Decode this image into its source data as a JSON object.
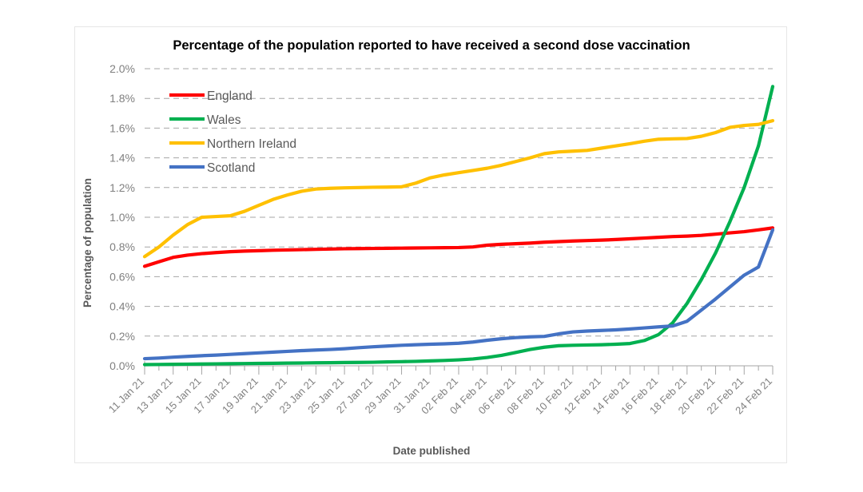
{
  "chart_data": {
    "type": "line",
    "title": "Percentage of the population reported to have received a second dose vaccination",
    "xlabel": "Date published",
    "ylabel": "Percentage of population",
    "ylim": [
      0,
      2.0
    ],
    "ytick_step": 0.2,
    "ytick_labels": [
      "0.0%",
      "0.2%",
      "0.4%",
      "0.6%",
      "0.8%",
      "1.0%",
      "1.2%",
      "1.4%",
      "1.6%",
      "1.8%",
      "2.0%"
    ],
    "grid": true,
    "legend_position": "top-left",
    "unit": "%",
    "x": [
      "11 Jan 21",
      "12 Jan 21",
      "13 Jan 21",
      "14 Jan 21",
      "15 Jan 21",
      "16 Jan 21",
      "17 Jan 21",
      "18 Jan 21",
      "19 Jan 21",
      "20 Jan 21",
      "21 Jan 21",
      "22 Jan 21",
      "23 Jan 21",
      "24 Jan 21",
      "25 Jan 21",
      "26 Jan 21",
      "27 Jan 21",
      "28 Jan 21",
      "29 Jan 21",
      "30 Jan 21",
      "31 Jan 21",
      "01 Feb 21",
      "02 Feb 21",
      "03 Feb 21",
      "04 Feb 21",
      "05 Feb 21",
      "06 Feb 21",
      "07 Feb 21",
      "08 Feb 21",
      "09 Feb 21",
      "10 Feb 21",
      "11 Feb 21",
      "12 Feb 21",
      "13 Feb 21",
      "14 Feb 21",
      "15 Feb 21",
      "16 Feb 21",
      "17 Feb 21",
      "18 Feb 21",
      "19 Feb 21",
      "20 Feb 21",
      "21 Feb 21",
      "22 Feb 21",
      "23 Feb 21",
      "24 Feb 21"
    ],
    "xtick_labels": [
      "11 Jan 21",
      "13 Jan 21",
      "15 Jan 21",
      "17 Jan 21",
      "19 Jan 21",
      "21 Jan 21",
      "23 Jan 21",
      "25 Jan 21",
      "27 Jan 21",
      "29 Jan 21",
      "31 Jan 21",
      "02 Feb 21",
      "04 Feb 21",
      "06 Feb 21",
      "08 Feb 21",
      "10 Feb 21",
      "12 Feb 21",
      "14 Feb 21",
      "16 Feb 21",
      "18 Feb 21",
      "20 Feb 21",
      "22 Feb 21",
      "24 Feb 21"
    ],
    "xtick_label_interval": 2,
    "series": [
      {
        "name": "England",
        "color": "#FF0000",
        "values": [
          0.67,
          0.7,
          0.73,
          0.745,
          0.755,
          0.762,
          0.768,
          0.772,
          0.775,
          0.778,
          0.78,
          0.782,
          0.784,
          0.786,
          0.788,
          0.789,
          0.79,
          0.791,
          0.792,
          0.793,
          0.794,
          0.795,
          0.796,
          0.8,
          0.812,
          0.818,
          0.822,
          0.826,
          0.832,
          0.836,
          0.84,
          0.843,
          0.846,
          0.85,
          0.855,
          0.86,
          0.865,
          0.87,
          0.873,
          0.878,
          0.886,
          0.895,
          0.903,
          0.915,
          0.928
        ]
      },
      {
        "name": "Wales",
        "color": "#00B050",
        "values": [
          0.008,
          0.009,
          0.01,
          0.011,
          0.012,
          0.013,
          0.014,
          0.015,
          0.016,
          0.017,
          0.018,
          0.019,
          0.02,
          0.021,
          0.022,
          0.023,
          0.024,
          0.026,
          0.028,
          0.03,
          0.033,
          0.036,
          0.04,
          0.046,
          0.056,
          0.07,
          0.09,
          0.11,
          0.125,
          0.135,
          0.138,
          0.14,
          0.142,
          0.145,
          0.15,
          0.17,
          0.21,
          0.29,
          0.42,
          0.58,
          0.76,
          0.97,
          1.2,
          1.48,
          1.88
        ]
      },
      {
        "name": "Northern Ireland",
        "color": "#FFC000",
        "values": [
          0.735,
          0.8,
          0.88,
          0.95,
          1.0,
          1.005,
          1.01,
          1.04,
          1.08,
          1.12,
          1.15,
          1.175,
          1.19,
          1.195,
          1.198,
          1.2,
          1.202,
          1.203,
          1.205,
          1.23,
          1.265,
          1.285,
          1.3,
          1.315,
          1.33,
          1.35,
          1.375,
          1.4,
          1.428,
          1.44,
          1.445,
          1.45,
          1.465,
          1.48,
          1.495,
          1.512,
          1.525,
          1.528,
          1.53,
          1.545,
          1.57,
          1.605,
          1.618,
          1.625,
          1.65
        ]
      },
      {
        "name": "Scotland",
        "color": "#4472C4",
        "values": [
          0.048,
          0.052,
          0.058,
          0.063,
          0.068,
          0.072,
          0.077,
          0.082,
          0.087,
          0.092,
          0.097,
          0.102,
          0.106,
          0.11,
          0.115,
          0.122,
          0.128,
          0.133,
          0.138,
          0.142,
          0.145,
          0.148,
          0.152,
          0.16,
          0.172,
          0.182,
          0.19,
          0.195,
          0.198,
          0.215,
          0.228,
          0.234,
          0.238,
          0.242,
          0.248,
          0.255,
          0.262,
          0.268,
          0.3,
          0.375,
          0.45,
          0.53,
          0.61,
          0.665,
          0.915
        ]
      }
    ]
  },
  "legend": {
    "items": [
      {
        "label": "England"
      },
      {
        "label": "Wales"
      },
      {
        "label": "Northern Ireland"
      },
      {
        "label": "Scotland"
      }
    ]
  }
}
